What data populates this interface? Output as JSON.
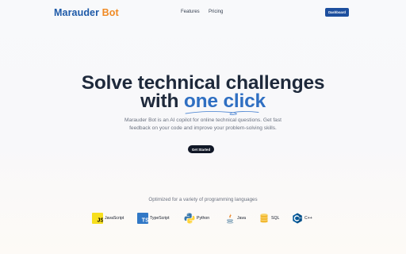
{
  "header": {
    "logo_part1": "Marauder",
    "logo_part2": "Bot",
    "nav": {
      "features": "Features",
      "pricing": "Pricing"
    },
    "dashboard_label": "Dashboard"
  },
  "hero": {
    "title_line1": "Solve technical challenges",
    "title_line2_prefix": "with",
    "title_line2_accent": "one click",
    "subtitle_line1": "Marauder Bot is an AI copilot for online technical questions. Get fast",
    "subtitle_line2": "feedback on your code and improve your problem-solving skills.",
    "cta_label": "Get Started"
  },
  "languages": {
    "heading": "Optimized for a variety of programming languages",
    "items": [
      {
        "label": "JavaScript",
        "icon": "javascript-icon"
      },
      {
        "label": "TypeScript",
        "icon": "typescript-icon"
      },
      {
        "label": "Python",
        "icon": "python-icon"
      },
      {
        "label": "Java",
        "icon": "java-icon"
      },
      {
        "label": "SQL",
        "icon": "sql-icon"
      },
      {
        "label": "C++",
        "icon": "cpp-icon"
      }
    ]
  },
  "colors": {
    "brand_blue": "#1e5aa8",
    "brand_orange": "#f08a24",
    "accent_blue": "#2f6fc2",
    "cta_dark": "#111827"
  }
}
